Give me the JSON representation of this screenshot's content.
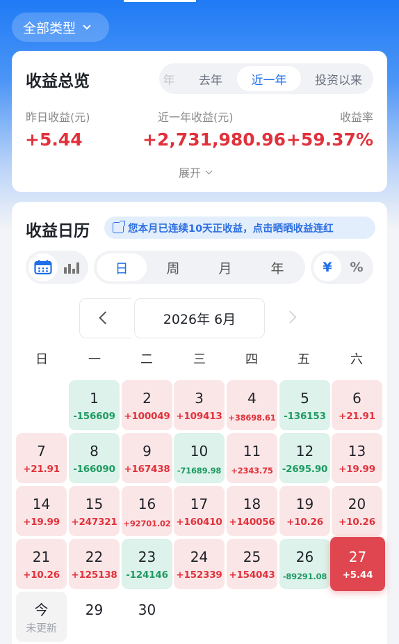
{
  "header": {
    "type_filter": "全部类型"
  },
  "overview": {
    "title": "收益总览",
    "ranges": [
      {
        "label": "年"
      },
      {
        "label": "去年"
      },
      {
        "label": "近一年",
        "active": true
      },
      {
        "label": "投资以来"
      }
    ],
    "stats": [
      {
        "label": "昨日收益(元)",
        "value": "+5.44"
      },
      {
        "label": "近一年收益(元)",
        "value": "+2,731,980.96"
      },
      {
        "label": "收益率",
        "value": "+59.37%"
      }
    ],
    "expand_label": "展开"
  },
  "calendar": {
    "title": "收益日历",
    "banner": "您本月已连续10天正收益，点击晒晒收益连红",
    "periods": [
      "日",
      "周",
      "月",
      "年"
    ],
    "active_period": "日",
    "units": [
      "¥",
      "%"
    ],
    "active_unit": "¥",
    "month_label": "2026年 6月",
    "weekdays": [
      "日",
      "一",
      "二",
      "三",
      "四",
      "五",
      "六"
    ],
    "days": [
      {
        "day": "1",
        "value": "-156609"
      },
      {
        "day": "2",
        "value": "+100049"
      },
      {
        "day": "3",
        "value": "+109413"
      },
      {
        "day": "4",
        "value": "+38698.61"
      },
      {
        "day": "5",
        "value": "-136153"
      },
      {
        "day": "6",
        "value": "+21.91"
      },
      {
        "day": "7",
        "value": "+21.91"
      },
      {
        "day": "8",
        "value": "-166090"
      },
      {
        "day": "9",
        "value": "+167438"
      },
      {
        "day": "10",
        "value": "-71689.98"
      },
      {
        "day": "11",
        "value": "+2343.75"
      },
      {
        "day": "12",
        "value": "-2695.90"
      },
      {
        "day": "13",
        "value": "+19.99"
      },
      {
        "day": "14",
        "value": "+19.99"
      },
      {
        "day": "15",
        "value": "+247321"
      },
      {
        "day": "16",
        "value": "+92701.02"
      },
      {
        "day": "17",
        "value": "+160410"
      },
      {
        "day": "18",
        "value": "+140056"
      },
      {
        "day": "19",
        "value": "+10.26"
      },
      {
        "day": "20",
        "value": "+10.26"
      },
      {
        "day": "21",
        "value": "+10.26"
      },
      {
        "day": "22",
        "value": "+125138"
      },
      {
        "day": "23",
        "value": "-124146"
      },
      {
        "day": "24",
        "value": "+152339"
      },
      {
        "day": "25",
        "value": "+154043"
      },
      {
        "day": "26",
        "value": "-89291.08"
      },
      {
        "day": "27",
        "value": "+5.44",
        "selected": true
      },
      {
        "day": "今",
        "value": "未更新",
        "today": true
      },
      {
        "day": "29",
        "value": ""
      },
      {
        "day": "30",
        "value": ""
      }
    ]
  },
  "colors": {
    "accent": "#1e6fe8",
    "gain": "#e0323c",
    "loss": "#1f9a63",
    "selected": "#e0464f"
  }
}
